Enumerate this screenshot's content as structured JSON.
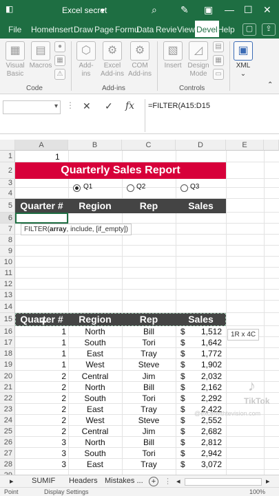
{
  "titlebar": {
    "title": "Excel secret",
    "caret": "▾"
  },
  "tabs": [
    "File",
    "Home",
    "Insert",
    "Draw",
    "Page",
    "Formu",
    "Data",
    "Revie",
    "View",
    "Devel",
    "Help"
  ],
  "active_tab": "Devel",
  "ribbon": {
    "code": {
      "visual_basic_1": "Visual",
      "visual_basic_2": "Basic",
      "macros": "Macros",
      "group": "Code"
    },
    "addins": {
      "addins_1": "Add-",
      "addins_2": "ins",
      "excel_1": "Excel",
      "excel_2": "Add-ins",
      "com_1": "COM",
      "com_2": "Add-ins",
      "group": "Add-ins"
    },
    "controls": {
      "insert": "Insert",
      "design_1": "Design",
      "design_2": "Mode",
      "group": "Controls"
    },
    "xml": {
      "label": "XML"
    }
  },
  "formula_bar": {
    "cancel": "✕",
    "enter": "✓",
    "fx": "fx",
    "formula": "=FILTER(A15:D15"
  },
  "columns": [
    "A",
    "B",
    "C",
    "D",
    "E"
  ],
  "rows": [
    "1",
    "2",
    "3",
    "4",
    "5",
    "6",
    "7",
    "8",
    "9",
    "10",
    "11",
    "12",
    "13",
    "14",
    "15",
    "16",
    "17",
    "18",
    "19",
    "20",
    "21",
    "22",
    "23",
    "24",
    "25",
    "26",
    "27",
    "28",
    "29"
  ],
  "cell_a1": "1",
  "report_title": "Quarterly Sales Report",
  "radios": [
    "Q1",
    "Q2",
    "Q3"
  ],
  "headers": [
    "Quarter #",
    "Region",
    "Rep",
    "Sales"
  ],
  "tooltip": {
    "fn": "FILTER(",
    "arg": "array",
    ", rest": ", include, [if_empty])"
  },
  "range_tip": "1R x 4C",
  "data": [
    {
      "q": "1",
      "region": "North",
      "rep": "Bill",
      "cur": "$",
      "sales": "1,512"
    },
    {
      "q": "1",
      "region": "South",
      "rep": "Tori",
      "cur": "$",
      "sales": "1,642"
    },
    {
      "q": "1",
      "region": "East",
      "rep": "Tray",
      "cur": "$",
      "sales": "1,772"
    },
    {
      "q": "1",
      "region": "West",
      "rep": "Steve",
      "cur": "$",
      "sales": "1,902"
    },
    {
      "q": "2",
      "region": "Central",
      "rep": "Jim",
      "cur": "$",
      "sales": "2,032"
    },
    {
      "q": "2",
      "region": "North",
      "rep": "Bill",
      "cur": "$",
      "sales": "2,162"
    },
    {
      "q": "2",
      "region": "South",
      "rep": "Tori",
      "cur": "$",
      "sales": "2,292"
    },
    {
      "q": "2",
      "region": "East",
      "rep": "Tray",
      "cur": "$",
      "sales": "2,422"
    },
    {
      "q": "2",
      "region": "West",
      "rep": "Steve",
      "cur": "$",
      "sales": "2,552"
    },
    {
      "q": "2",
      "region": "Central",
      "rep": "Jim",
      "cur": "$",
      "sales": "2,682"
    },
    {
      "q": "3",
      "region": "North",
      "rep": "Bill",
      "cur": "$",
      "sales": "2,812"
    },
    {
      "q": "3",
      "region": "South",
      "rep": "Tori",
      "cur": "$",
      "sales": "2,942"
    },
    {
      "q": "3",
      "region": "East",
      "rep": "Tray",
      "cur": "$",
      "sales": "3,072"
    }
  ],
  "sheet_tabs": [
    "SUMIF",
    "Headers",
    "Mistakes ..."
  ],
  "status": {
    "mode": "Point",
    "display": "Display Settings",
    "zoom": "100%"
  },
  "watermark": {
    "brand": "TikTok",
    "handle": "@excelwithtevision.com"
  },
  "colors": {
    "excel_green": "#1e6e42",
    "title_band": "#d7003a",
    "header_band": "#444444"
  }
}
